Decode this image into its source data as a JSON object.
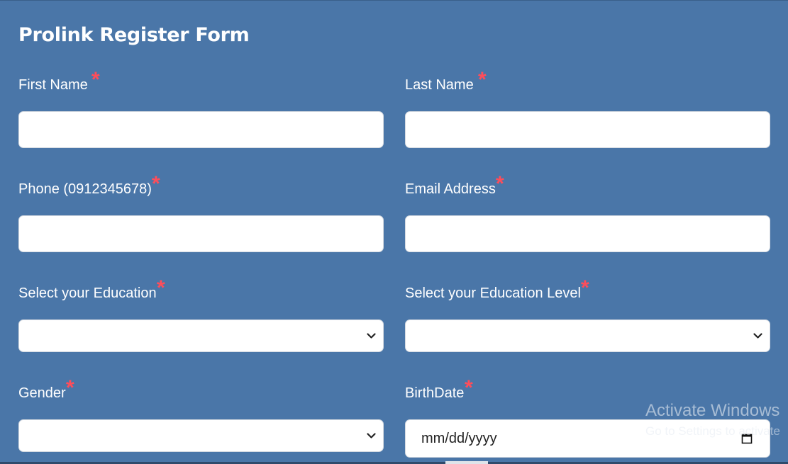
{
  "form": {
    "title": "Prolink Register Form",
    "required_mark": "*",
    "first_name": {
      "label": "First Name",
      "value": ""
    },
    "last_name": {
      "label": "Last Name",
      "value": ""
    },
    "phone": {
      "label": "Phone (0912345678)",
      "value": ""
    },
    "email": {
      "label": "Email Address",
      "value": ""
    },
    "education": {
      "label": "Select your Education",
      "selected": ""
    },
    "education_level": {
      "label": "Select your Education Level",
      "selected": ""
    },
    "gender": {
      "label": "Gender",
      "selected": ""
    },
    "birthdate": {
      "label": "BirthDate",
      "placeholder": "mm/dd/yyyy"
    }
  },
  "watermark": {
    "title": "Activate Windows",
    "subtitle": "Go to Settings to activate"
  },
  "icons": {
    "select_arrow": "chevron-down-icon",
    "date_picker": "calendar-icon"
  },
  "colors": {
    "background": "#4a76a8",
    "required": "#ff4d5a",
    "input_bg": "#ffffff"
  }
}
